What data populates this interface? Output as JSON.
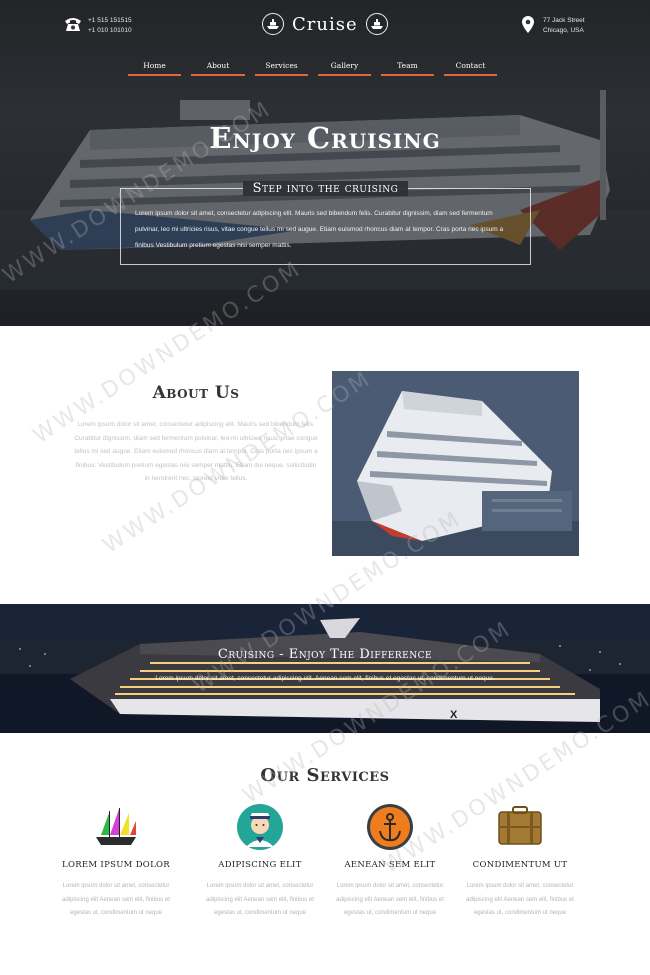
{
  "header": {
    "phone_lines": [
      "+1 515 151515",
      "+1 010 101010"
    ],
    "brand": "Cruise",
    "address_lines": [
      "77 Jack Street",
      "Chicago, USA"
    ]
  },
  "nav": [
    {
      "label": "Home"
    },
    {
      "label": "About"
    },
    {
      "label": "Services"
    },
    {
      "label": "Gallery"
    },
    {
      "label": "Team"
    },
    {
      "label": "Contact"
    }
  ],
  "hero": {
    "heading": "Enjoy Cruising",
    "box_title": "Step into the cruising",
    "box_text": "Lorem ipsum dolor sit amet, consectetur adipiscing elit. Mauris sed bibendum felis. Curabitur dignissim, diam sed fermentum pulvinar, leo mi ultricies risus, vitae congue tellus mi sed augue. Etiam euismod rhoncus diam at tempor. Cras porta nec ipsum a finibus Vestibulum pretium egestas nisi semper mattis."
  },
  "about": {
    "title": "About Us",
    "text": "Lorem ipsum dolor sit amet, consectetur adipiscing elit. Mauris sed bibendum felis. Curabitur dignissim, diam sed fermentum pulvinar, leo mi ultricies risus, vitae congue tellus mi sed augue. Etiam euismod rhoncus diam at tempor. Cras porta nec ipsum a finibus. Vestibulum pretium egestas nisi semper mattis. Etiam dui neque, sollicitudin in hendrerit nec, laoreet vitae tellus."
  },
  "banner": {
    "title": "Cruising - Enjoy The Difference",
    "text": "Lorem ipsum dolor sit amet, consectetur adipiscing elit. Aenean sem elit, finibus et egestas ut, condimentum ut neque."
  },
  "services": {
    "title": "Our Services",
    "items": [
      {
        "name": "LOREM IPSUM DOLOR",
        "icon": "sailing-ship-icon",
        "text": "Lorem ipsum dolor sit amet, consectetur adipiscing elit Aenean sem elit, finibus et egestas ut, condimentum ut neque"
      },
      {
        "name": "ADIPISCING ELIT",
        "icon": "sailor-icon",
        "text": "Lorem ipsum dolor sit amet, consectetur adipiscing elit Aenean sem elit, finibus et egestas ut, condimentum ut neque"
      },
      {
        "name": "AENEAN SEM ELIT",
        "icon": "anchor-icon",
        "text": "Lorem ipsum dolor sit amet, consectetur adipiscing elit Aenean sem elit, finibus et egestas ut, condimentum ut neque"
      },
      {
        "name": "CONDIMENTUM UT",
        "icon": "suitcase-icon",
        "text": "Lorem ipsum dolor sit amet, consectetur adipiscing elit Aenean sem elit, finibus et egestas ut, condimentum ut neque"
      }
    ]
  },
  "watermark": "WWW.DOWNDEMO.COM",
  "colors": {
    "accent": "#e0683d",
    "hero_bg": "#2f3236",
    "banner_bg": "#0e1320"
  }
}
